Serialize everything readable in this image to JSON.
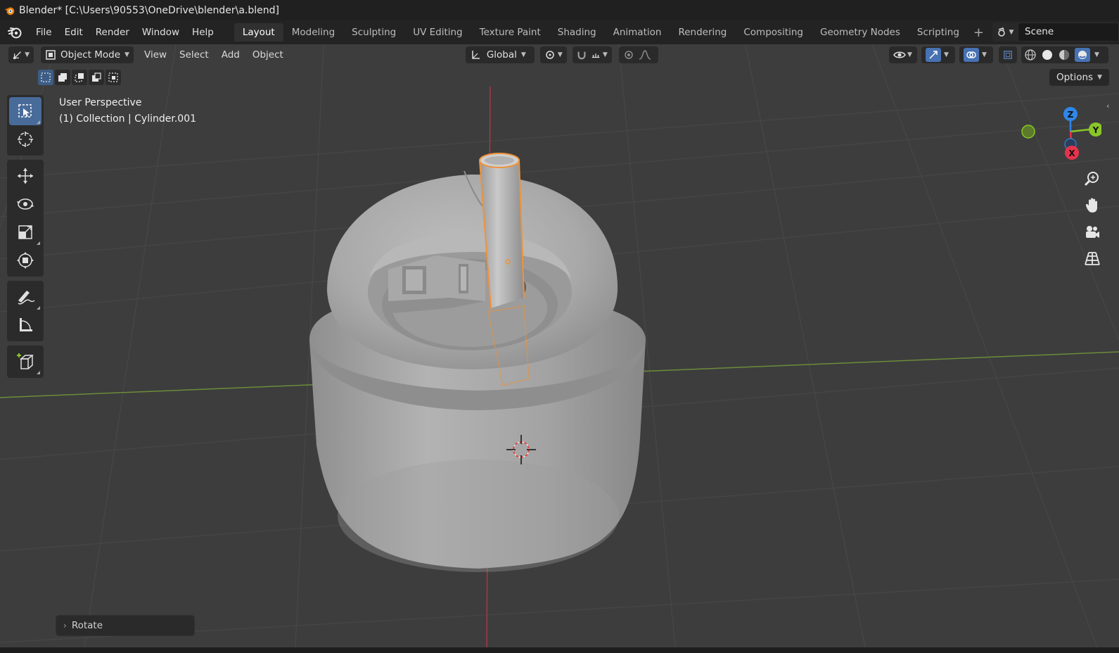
{
  "window": {
    "title": "Blender* [C:\\Users\\90553\\OneDrive\\blender\\a.blend]"
  },
  "menu": [
    "File",
    "Edit",
    "Render",
    "Window",
    "Help"
  ],
  "workspaces": [
    "Layout",
    "Modeling",
    "Sculpting",
    "UV Editing",
    "Texture Paint",
    "Shading",
    "Animation",
    "Rendering",
    "Compositing",
    "Geometry Nodes",
    "Scripting"
  ],
  "active_workspace": "Layout",
  "scene": {
    "name": "Scene"
  },
  "viewport_header": {
    "mode": "Object Mode",
    "menus": [
      "View",
      "Select",
      "Add",
      "Object"
    ],
    "transform_orientation": "Global",
    "options_label": "Options"
  },
  "viewport_overlay": {
    "perspective": "User Perspective",
    "collection_info": "(1) Collection | Cylinder.001"
  },
  "gizmo": {
    "z": "Z",
    "y": "Y",
    "x": "X"
  },
  "last_operator": "Rotate",
  "colors": {
    "accent": "#4772b3",
    "selection_outline": "#f0923a",
    "x_axis": "#e8324c",
    "y_axis": "#8ac628",
    "z_axis": "#2f86e8",
    "grid_background": "#3d3d3d",
    "object_gray": "#a6a6a6"
  },
  "icons": {
    "app": "blender-logo-icon",
    "tools": [
      "select-box-icon",
      "cursor-icon",
      "move-icon",
      "rotate-icon",
      "scale-icon",
      "transform-icon",
      "annotate-icon",
      "measure-icon",
      "add-cube-icon"
    ],
    "nav": [
      "zoom-icon",
      "hand-pan-icon",
      "camera-icon",
      "ortho-grid-icon"
    ]
  }
}
